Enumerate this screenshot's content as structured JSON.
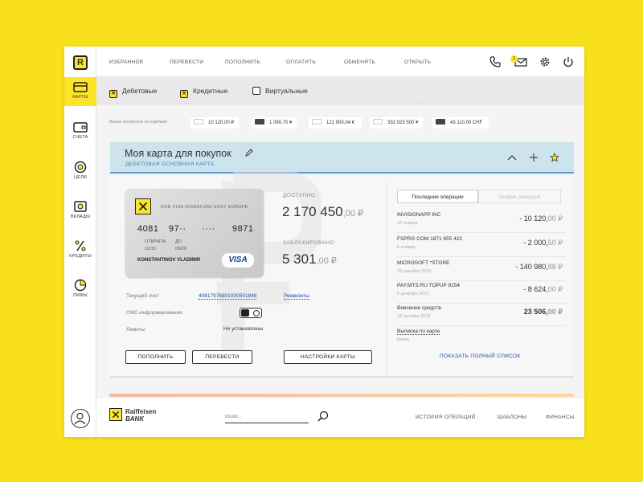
{
  "sidebar": {
    "logo": "R",
    "items": [
      {
        "label": "КАРТЫ",
        "icon": "card-icon",
        "active": true
      },
      {
        "label": "СЧЕТА",
        "icon": "wallet-icon"
      },
      {
        "label": "ЦЕЛИ",
        "icon": "target-icon"
      },
      {
        "label": "ВКЛАДЫ",
        "icon": "deposit-icon"
      },
      {
        "label": "КРЕДИТЫ",
        "icon": "percent-icon"
      },
      {
        "label": "ПИФЫ",
        "icon": "pie-chart-icon"
      }
    ],
    "avatar_icon": "user-icon"
  },
  "topnav": {
    "items": [
      "ИЗБРАННОЕ",
      "ПЕРЕВЕСТИ",
      "ПОПОЛНИТЬ",
      "ОПЛАТИТЬ",
      "ОБМЕНЯТЬ",
      "ОТКРЫТЬ"
    ],
    "icons": [
      "phone-icon",
      "mail-icon",
      "gear-icon",
      "power-icon"
    ],
    "mail_badge": "2"
  },
  "filters": [
    {
      "label": "Дебетовые",
      "checked": true
    },
    {
      "label": "Кредитные",
      "checked": true
    },
    {
      "label": "Виртуальные",
      "checked": false
    }
  ],
  "summary": {
    "label": "Всего доступно по картам:",
    "chips": [
      {
        "amount": "10 120,00",
        "currency": "₽",
        "brand": "visa"
      },
      {
        "amount": "1 090,70",
        "currency": "¥",
        "brand": "mastercard"
      },
      {
        "amount": "121 900,04",
        "currency": "€",
        "brand": "visa"
      },
      {
        "amount": "332 023 500",
        "currency": "¥",
        "brand": "visa"
      },
      {
        "amount": "43 110,00",
        "currency": "CHF",
        "brand": "mastercard"
      }
    ]
  },
  "card_header": {
    "title": "Моя карта для покупок",
    "subtitle": "ДЕБЕТОВАЯ ОСНОВНАЯ КАРТА"
  },
  "card": {
    "type": "RUR VISA SIGNATURE EASY EUROPE",
    "number_groups": [
      "4081",
      "97··",
      "····",
      "9871"
    ],
    "opened_label": "ОТКРЫТА",
    "opened": "12/15",
    "until_label": "ДО",
    "until": "09/20",
    "holder": "KONSTANTINOV VLADIMIR",
    "brand": "VISA"
  },
  "balance": {
    "available_label": "ДОСТУПНО",
    "available_int": "2 170 450",
    "available_dec": ",00 ₽",
    "blocked_label": "ЗАБЛОКИРОВАНО",
    "blocked_int": "5 301",
    "blocked_dec": ",00 ₽"
  },
  "details": {
    "account_label": "Текущий счет",
    "account_value": "40817978801000501848",
    "requisites": "Реквизиты",
    "sms_label": "СМС-информирование",
    "limits_label": "Лимиты",
    "limits_value": "Не установлены"
  },
  "buttons": {
    "topup": "ПОПОЛНИТЬ",
    "transfer": "ПЕРЕВЕСТИ",
    "settings": "НАСТРОЙКИ КАРТЫ"
  },
  "operations": {
    "tab_active": "Последние операции",
    "tab_inactive": "График расходов",
    "items": [
      {
        "name": "INVISIONAPP INC",
        "date": "12 января",
        "amount": "- 10 120,",
        "dec": "00 ₽"
      },
      {
        "name": "FSPRG COM 1871 655 422",
        "date": "5 января",
        "amount": "- 2 000,",
        "dec": "50 ₽"
      },
      {
        "name": "MICROSOFT *STORE",
        "date": "23 декабря 2015",
        "amount": "- 140 980,",
        "dec": "88 ₽"
      },
      {
        "name": "PAY.MTS.RU TOPUP 9154",
        "date": "6 декабря 2015",
        "amount": "- 8 624,",
        "dec": "00 ₽"
      },
      {
        "name": "Внесение средств",
        "date": "18 октября 2015",
        "amount": "23 506,",
        "dec": "00 ₽",
        "positive": true
      }
    ],
    "statement_title": "Выписка по карте",
    "statement_sub": "ранее",
    "show_all": "ПОКАЗАТЬ ПОЛНЫЙ СПИСОК"
  },
  "footer": {
    "brand_line1": "Raiffeisen",
    "brand_line2": "BANK",
    "search_placeholder": "поиск...",
    "links": [
      "ИСТОРИЯ ОПЕРАЦИЙ",
      "ШАБЛОНЫ",
      "ФИНАНСЫ"
    ]
  },
  "colors": {
    "accent": "#fde428",
    "background": "#f8e01a",
    "link": "#1a4fa0",
    "header_bg": "#cde4ec"
  }
}
